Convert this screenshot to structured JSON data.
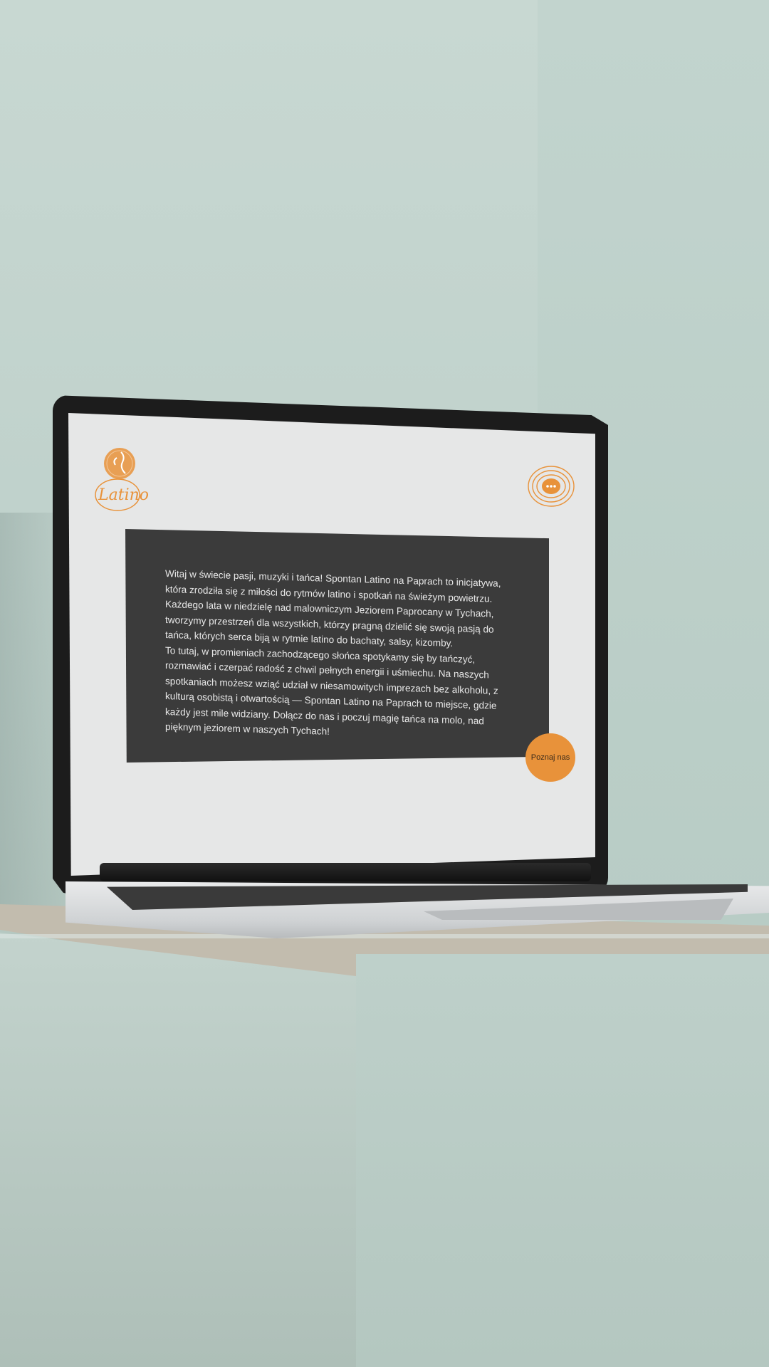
{
  "brand": {
    "logo_text": "Latino",
    "accent_color": "#e8923a",
    "panel_color": "#3b3b3b",
    "screen_color": "#e6e7e7"
  },
  "chat": {
    "icon": "chat-bubble-icon"
  },
  "intro": {
    "paragraph_1": "Witaj w świecie pasji, muzyki i tańca! Spontan Latino na Paprach to inicjatywa, która zrodziła się z miłości do rytmów latino i spotkań na świeżym powietrzu. Każdego lata w niedzielę nad malowniczym Jeziorem Paprocany w Tychach, tworzymy przestrzeń dla wszystkich, którzy pragną dzielić się swoją pasją do tańca, których serca biją w rytmie latino do bachaty, salsy, kizomby.",
    "paragraph_2": "To tutaj, w promieniach zachodzącego słońca spotykamy się by tańczyć, rozmawiać i czerpać radość z chwil pełnych energii i uśmiechu. Na naszych spotkaniach możesz wziąć udział w niesamowitych imprezach bez alkoholu, z kulturą osobistą i otwartością — Spontan Latino na Paprach to miejsce, gdzie każdy jest mile widziany. Dołącz do nas i poczuj magię tańca na molo, nad pięknym jeziorem w naszych Tychach!"
  },
  "cta": {
    "label": "Poznaj nas"
  }
}
